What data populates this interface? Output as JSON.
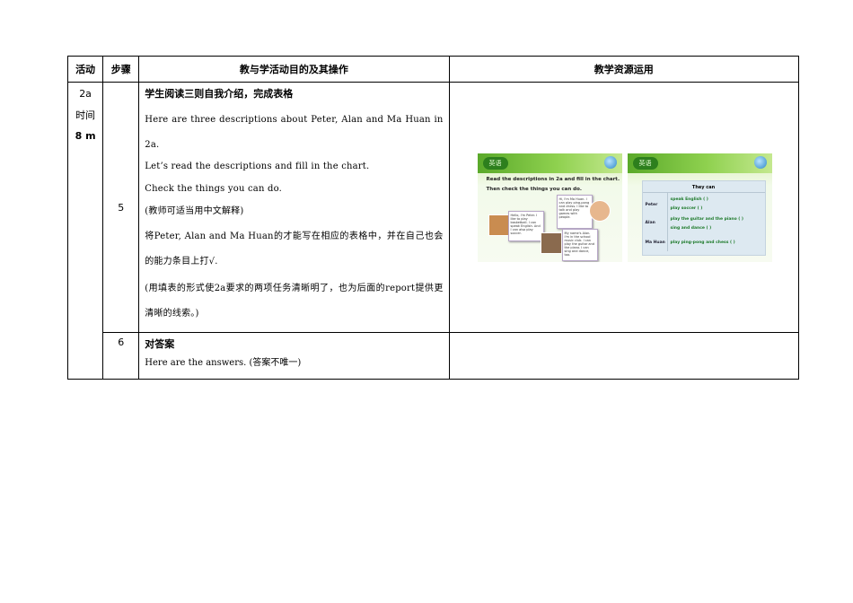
{
  "headers": {
    "activity": "活动",
    "step": "步骤",
    "operations": "教与学活动目的及其操作",
    "resources": "教学资源运用"
  },
  "activity": {
    "code": "2a",
    "time_label": "时间",
    "duration": "8 m"
  },
  "rows": [
    {
      "step": "5",
      "heading": "学生阅读三则自我介绍，完成表格",
      "lines": [
        "Here are three descriptions about Peter, Alan and Ma Huan in 2a.",
        "Let’s read the descriptions and fill in the chart.",
        "Check the things you can do.",
        "(教师可适当用中文解释)",
        "将Peter, Alan and Ma Huan的才能写在相应的表格中，并在自己也会的能力条目上打√.",
        "(用填表的形式使2a要求的两项任务清晰明了，也为后面的report提供更清晰的线索。)"
      ]
    },
    {
      "step": "6",
      "heading": "对答案",
      "lines": [
        "Here are the answers. (答案不唯一)"
      ]
    }
  ],
  "slide1": {
    "logo": "英语",
    "line1": "Read the descriptions in 2a and fill in the chart.",
    "line2": "Then check the things you can do.",
    "card1": "Hello, I'm Peter. I like to play basketball. I can speak English. And I can also play soccer.",
    "card2": "Hi, I'm Ma Huan. I can play ping-pong and chess. I like to talk and play games with people.",
    "card3": "My name's Alan. I'm in the school music club. I can play the guitar and the piano. I can sing and dance, too."
  },
  "slide2": {
    "logo": "英语",
    "chart_title": "They can",
    "names": [
      "Peter",
      "Alan",
      "Ma Huan"
    ],
    "items": [
      "speak English (      )",
      "play soccer (      )",
      "play the guitar and the piano (      )",
      "sing and dance (      )",
      "play ping-pong and chess (      )"
    ]
  },
  "colors": {
    "slide_green": "#5aa92a",
    "chart_blue": "#dde9f1",
    "item_green": "#1d7a2a"
  }
}
